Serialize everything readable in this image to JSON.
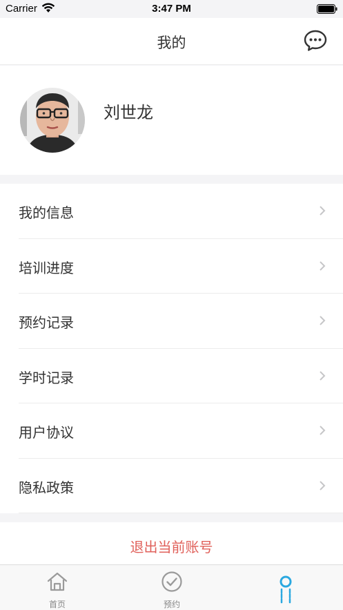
{
  "status_bar": {
    "carrier": "Carrier",
    "time": "3:47 PM"
  },
  "header": {
    "title": "我的",
    "message_icon": "chat-bubble-icon"
  },
  "profile": {
    "name": "刘世龙",
    "avatar": "user-avatar-photo"
  },
  "menu": {
    "items": [
      {
        "label": "我的信息"
      },
      {
        "label": "培训进度"
      },
      {
        "label": "预约记录"
      },
      {
        "label": "学时记录"
      },
      {
        "label": "用户协议"
      },
      {
        "label": "隐私政策"
      }
    ],
    "chevron_icon": "chevron-right-icon"
  },
  "logout": {
    "label": "退出当前账号",
    "color": "#e0605a"
  },
  "tabbar": {
    "tabs": [
      {
        "label": "首页",
        "icon": "home-icon"
      },
      {
        "label": "预约",
        "icon": "check-circle-icon"
      },
      {
        "label": "",
        "icon": "profile-icon",
        "active": true
      }
    ],
    "active_color": "#2aa8e0"
  }
}
